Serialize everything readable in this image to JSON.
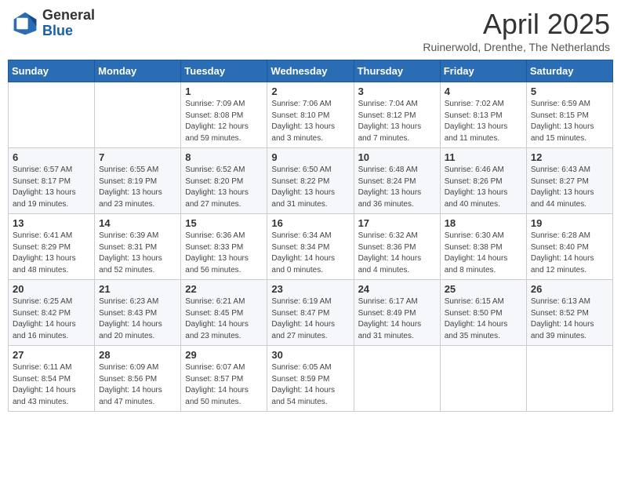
{
  "header": {
    "logo_general": "General",
    "logo_blue": "Blue",
    "title": "April 2025",
    "subtitle": "Ruinerwold, Drenthe, The Netherlands"
  },
  "weekdays": [
    "Sunday",
    "Monday",
    "Tuesday",
    "Wednesday",
    "Thursday",
    "Friday",
    "Saturday"
  ],
  "weeks": [
    [
      {
        "day": "",
        "sunrise": "",
        "sunset": "",
        "daylight": ""
      },
      {
        "day": "",
        "sunrise": "",
        "sunset": "",
        "daylight": ""
      },
      {
        "day": "1",
        "sunrise": "Sunrise: 7:09 AM",
        "sunset": "Sunset: 8:08 PM",
        "daylight": "Daylight: 12 hours and 59 minutes."
      },
      {
        "day": "2",
        "sunrise": "Sunrise: 7:06 AM",
        "sunset": "Sunset: 8:10 PM",
        "daylight": "Daylight: 13 hours and 3 minutes."
      },
      {
        "day": "3",
        "sunrise": "Sunrise: 7:04 AM",
        "sunset": "Sunset: 8:12 PM",
        "daylight": "Daylight: 13 hours and 7 minutes."
      },
      {
        "day": "4",
        "sunrise": "Sunrise: 7:02 AM",
        "sunset": "Sunset: 8:13 PM",
        "daylight": "Daylight: 13 hours and 11 minutes."
      },
      {
        "day": "5",
        "sunrise": "Sunrise: 6:59 AM",
        "sunset": "Sunset: 8:15 PM",
        "daylight": "Daylight: 13 hours and 15 minutes."
      }
    ],
    [
      {
        "day": "6",
        "sunrise": "Sunrise: 6:57 AM",
        "sunset": "Sunset: 8:17 PM",
        "daylight": "Daylight: 13 hours and 19 minutes."
      },
      {
        "day": "7",
        "sunrise": "Sunrise: 6:55 AM",
        "sunset": "Sunset: 8:19 PM",
        "daylight": "Daylight: 13 hours and 23 minutes."
      },
      {
        "day": "8",
        "sunrise": "Sunrise: 6:52 AM",
        "sunset": "Sunset: 8:20 PM",
        "daylight": "Daylight: 13 hours and 27 minutes."
      },
      {
        "day": "9",
        "sunrise": "Sunrise: 6:50 AM",
        "sunset": "Sunset: 8:22 PM",
        "daylight": "Daylight: 13 hours and 31 minutes."
      },
      {
        "day": "10",
        "sunrise": "Sunrise: 6:48 AM",
        "sunset": "Sunset: 8:24 PM",
        "daylight": "Daylight: 13 hours and 36 minutes."
      },
      {
        "day": "11",
        "sunrise": "Sunrise: 6:46 AM",
        "sunset": "Sunset: 8:26 PM",
        "daylight": "Daylight: 13 hours and 40 minutes."
      },
      {
        "day": "12",
        "sunrise": "Sunrise: 6:43 AM",
        "sunset": "Sunset: 8:27 PM",
        "daylight": "Daylight: 13 hours and 44 minutes."
      }
    ],
    [
      {
        "day": "13",
        "sunrise": "Sunrise: 6:41 AM",
        "sunset": "Sunset: 8:29 PM",
        "daylight": "Daylight: 13 hours and 48 minutes."
      },
      {
        "day": "14",
        "sunrise": "Sunrise: 6:39 AM",
        "sunset": "Sunset: 8:31 PM",
        "daylight": "Daylight: 13 hours and 52 minutes."
      },
      {
        "day": "15",
        "sunrise": "Sunrise: 6:36 AM",
        "sunset": "Sunset: 8:33 PM",
        "daylight": "Daylight: 13 hours and 56 minutes."
      },
      {
        "day": "16",
        "sunrise": "Sunrise: 6:34 AM",
        "sunset": "Sunset: 8:34 PM",
        "daylight": "Daylight: 14 hours and 0 minutes."
      },
      {
        "day": "17",
        "sunrise": "Sunrise: 6:32 AM",
        "sunset": "Sunset: 8:36 PM",
        "daylight": "Daylight: 14 hours and 4 minutes."
      },
      {
        "day": "18",
        "sunrise": "Sunrise: 6:30 AM",
        "sunset": "Sunset: 8:38 PM",
        "daylight": "Daylight: 14 hours and 8 minutes."
      },
      {
        "day": "19",
        "sunrise": "Sunrise: 6:28 AM",
        "sunset": "Sunset: 8:40 PM",
        "daylight": "Daylight: 14 hours and 12 minutes."
      }
    ],
    [
      {
        "day": "20",
        "sunrise": "Sunrise: 6:25 AM",
        "sunset": "Sunset: 8:42 PM",
        "daylight": "Daylight: 14 hours and 16 minutes."
      },
      {
        "day": "21",
        "sunrise": "Sunrise: 6:23 AM",
        "sunset": "Sunset: 8:43 PM",
        "daylight": "Daylight: 14 hours and 20 minutes."
      },
      {
        "day": "22",
        "sunrise": "Sunrise: 6:21 AM",
        "sunset": "Sunset: 8:45 PM",
        "daylight": "Daylight: 14 hours and 23 minutes."
      },
      {
        "day": "23",
        "sunrise": "Sunrise: 6:19 AM",
        "sunset": "Sunset: 8:47 PM",
        "daylight": "Daylight: 14 hours and 27 minutes."
      },
      {
        "day": "24",
        "sunrise": "Sunrise: 6:17 AM",
        "sunset": "Sunset: 8:49 PM",
        "daylight": "Daylight: 14 hours and 31 minutes."
      },
      {
        "day": "25",
        "sunrise": "Sunrise: 6:15 AM",
        "sunset": "Sunset: 8:50 PM",
        "daylight": "Daylight: 14 hours and 35 minutes."
      },
      {
        "day": "26",
        "sunrise": "Sunrise: 6:13 AM",
        "sunset": "Sunset: 8:52 PM",
        "daylight": "Daylight: 14 hours and 39 minutes."
      }
    ],
    [
      {
        "day": "27",
        "sunrise": "Sunrise: 6:11 AM",
        "sunset": "Sunset: 8:54 PM",
        "daylight": "Daylight: 14 hours and 43 minutes."
      },
      {
        "day": "28",
        "sunrise": "Sunrise: 6:09 AM",
        "sunset": "Sunset: 8:56 PM",
        "daylight": "Daylight: 14 hours and 47 minutes."
      },
      {
        "day": "29",
        "sunrise": "Sunrise: 6:07 AM",
        "sunset": "Sunset: 8:57 PM",
        "daylight": "Daylight: 14 hours and 50 minutes."
      },
      {
        "day": "30",
        "sunrise": "Sunrise: 6:05 AM",
        "sunset": "Sunset: 8:59 PM",
        "daylight": "Daylight: 14 hours and 54 minutes."
      },
      {
        "day": "",
        "sunrise": "",
        "sunset": "",
        "daylight": ""
      },
      {
        "day": "",
        "sunrise": "",
        "sunset": "",
        "daylight": ""
      },
      {
        "day": "",
        "sunrise": "",
        "sunset": "",
        "daylight": ""
      }
    ]
  ]
}
